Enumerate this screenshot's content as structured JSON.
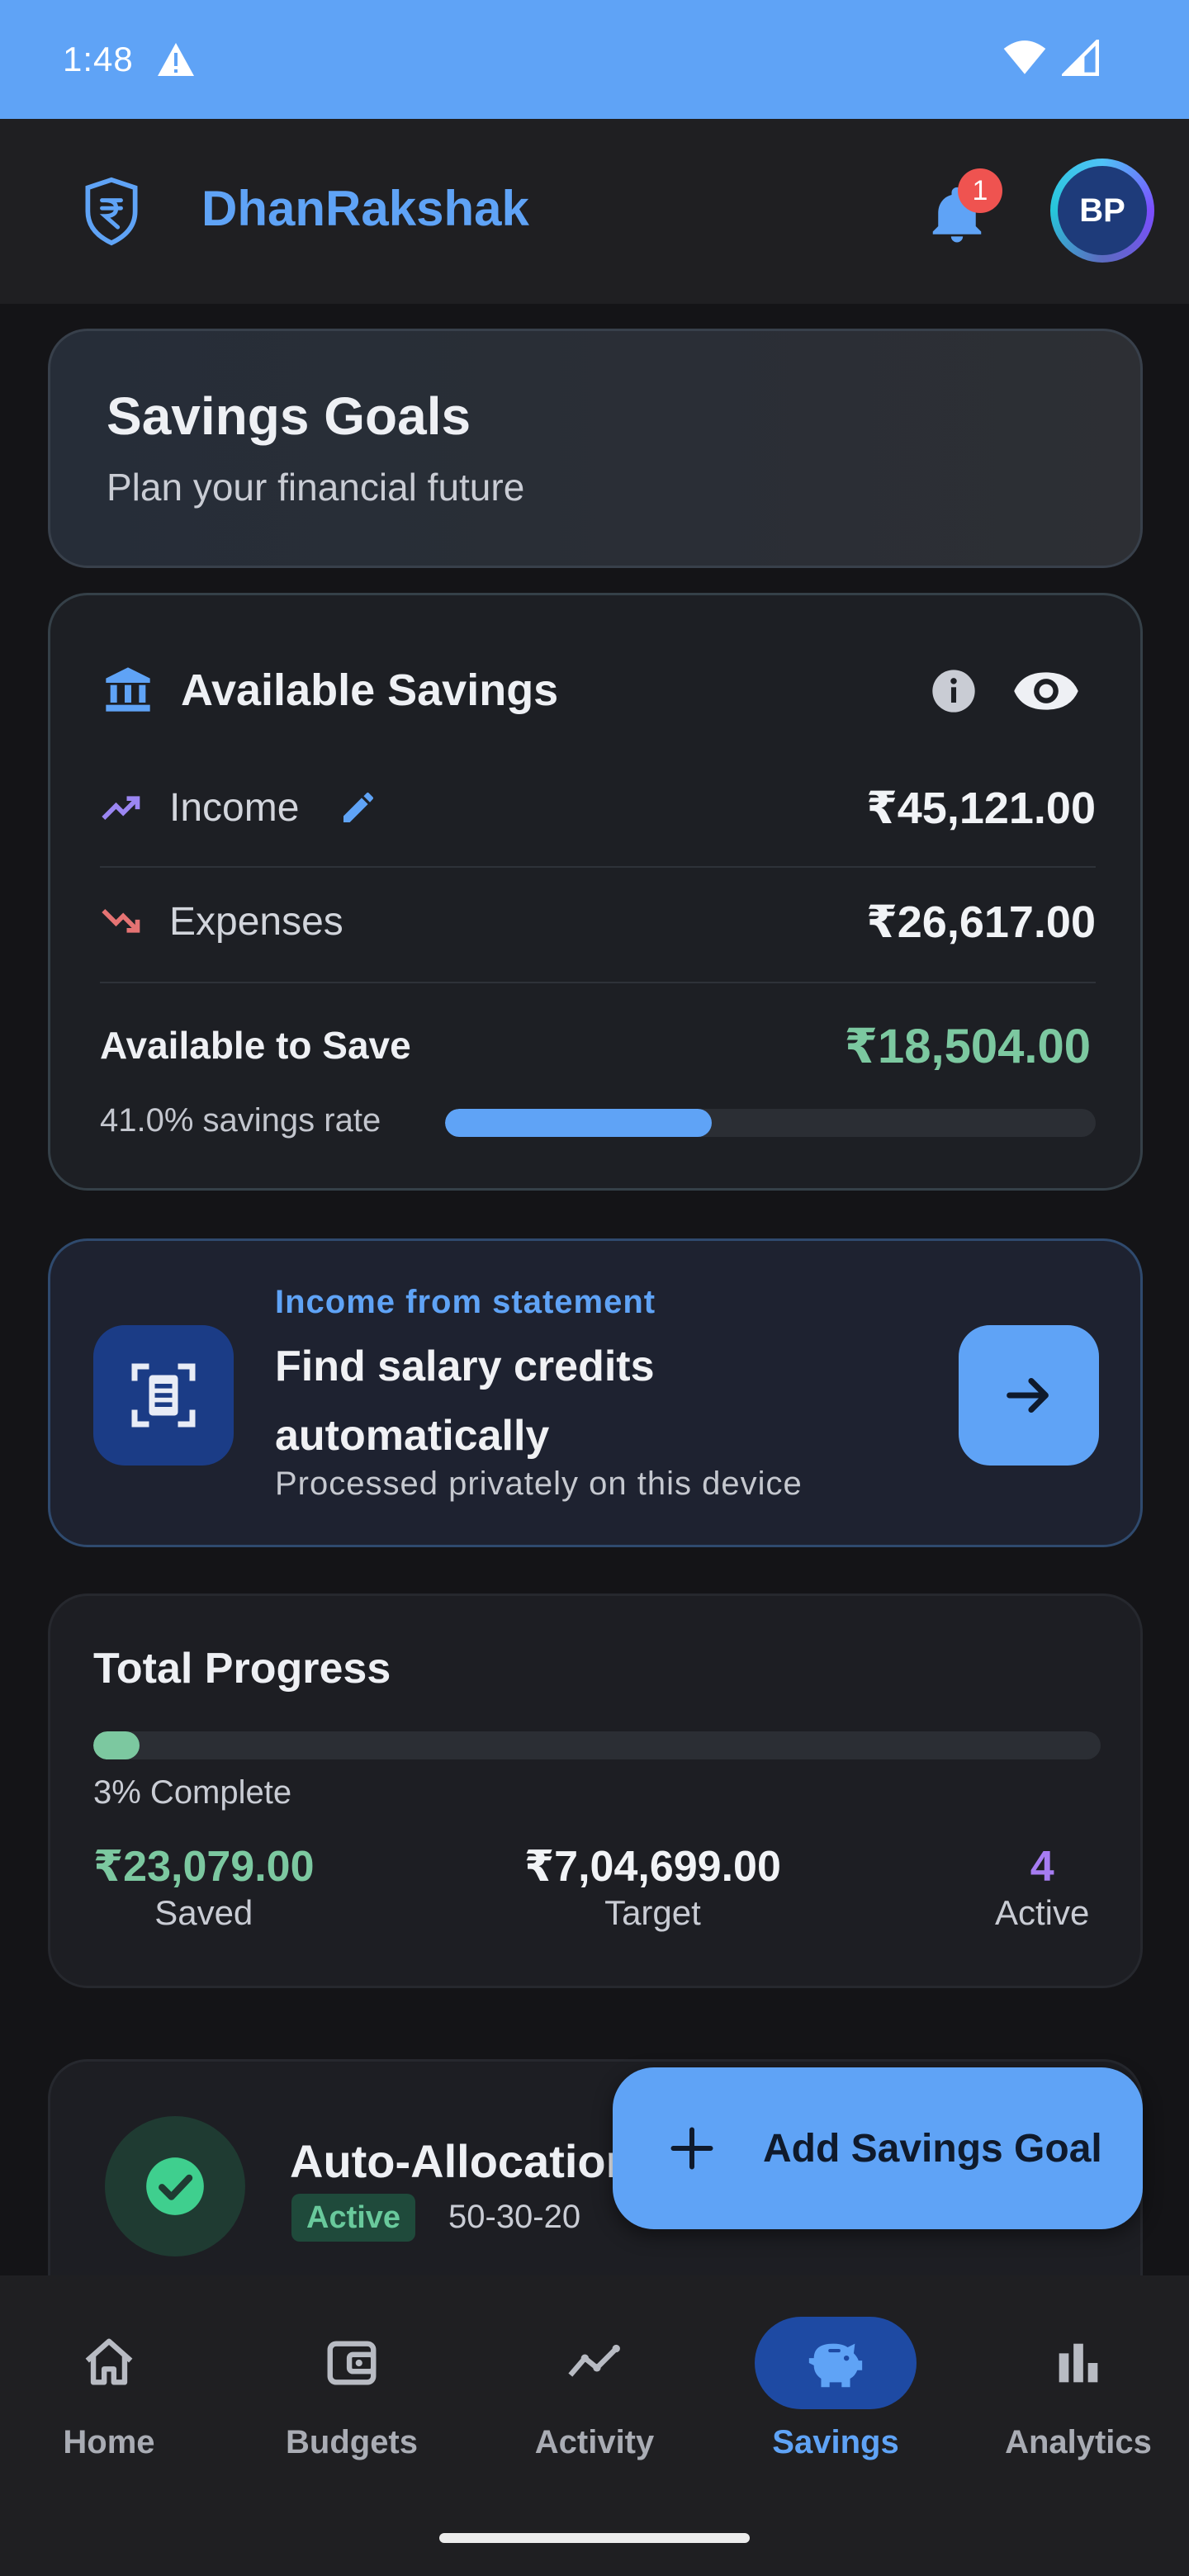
{
  "status_bar": {
    "time": "1:48"
  },
  "header": {
    "brand": "DhanRakshak",
    "notification_count": "1",
    "avatar_initials": "BP"
  },
  "hero": {
    "title": "Savings Goals",
    "subtitle": "Plan your financial future"
  },
  "available_savings": {
    "title": "Available Savings",
    "income_label": "Income",
    "income_value": "₹45,121.00",
    "expenses_label": "Expenses",
    "expenses_value": "₹26,617.00",
    "available_label": "Available to Save",
    "available_value": "₹18,504.00",
    "savings_rate_text": "41.0% savings rate",
    "savings_rate_fraction": 0.41
  },
  "statement_card": {
    "kicker": "Income from statement",
    "headline": "Find salary credits automatically",
    "subtext": "Processed privately on this device"
  },
  "total_progress": {
    "title": "Total Progress",
    "percent_text": "3% Complete",
    "progress_fraction": 0.03,
    "saved_value": "₹23,079.00",
    "saved_label": "Saved",
    "target_value": "₹7,04,699.00",
    "target_label": "Target",
    "active_value": "4",
    "active_label": "Active"
  },
  "auto_allocation": {
    "title": "Auto-Allocation",
    "status": "Active",
    "rule": "50-30-20"
  },
  "fab": {
    "label": "Add Savings Goal"
  },
  "nav": {
    "items": [
      {
        "label": "Home",
        "icon": "home-icon"
      },
      {
        "label": "Budgets",
        "icon": "wallet-icon"
      },
      {
        "label": "Activity",
        "icon": "activity-icon"
      },
      {
        "label": "Savings",
        "icon": "piggy-bank-icon"
      },
      {
        "label": "Analytics",
        "icon": "bar-chart-icon"
      }
    ],
    "active": "Savings"
  },
  "colors": {
    "accent": "#5fa3f6",
    "success": "#7cc8a0",
    "danger": "#ef5350",
    "purple": "#a67cf2"
  }
}
